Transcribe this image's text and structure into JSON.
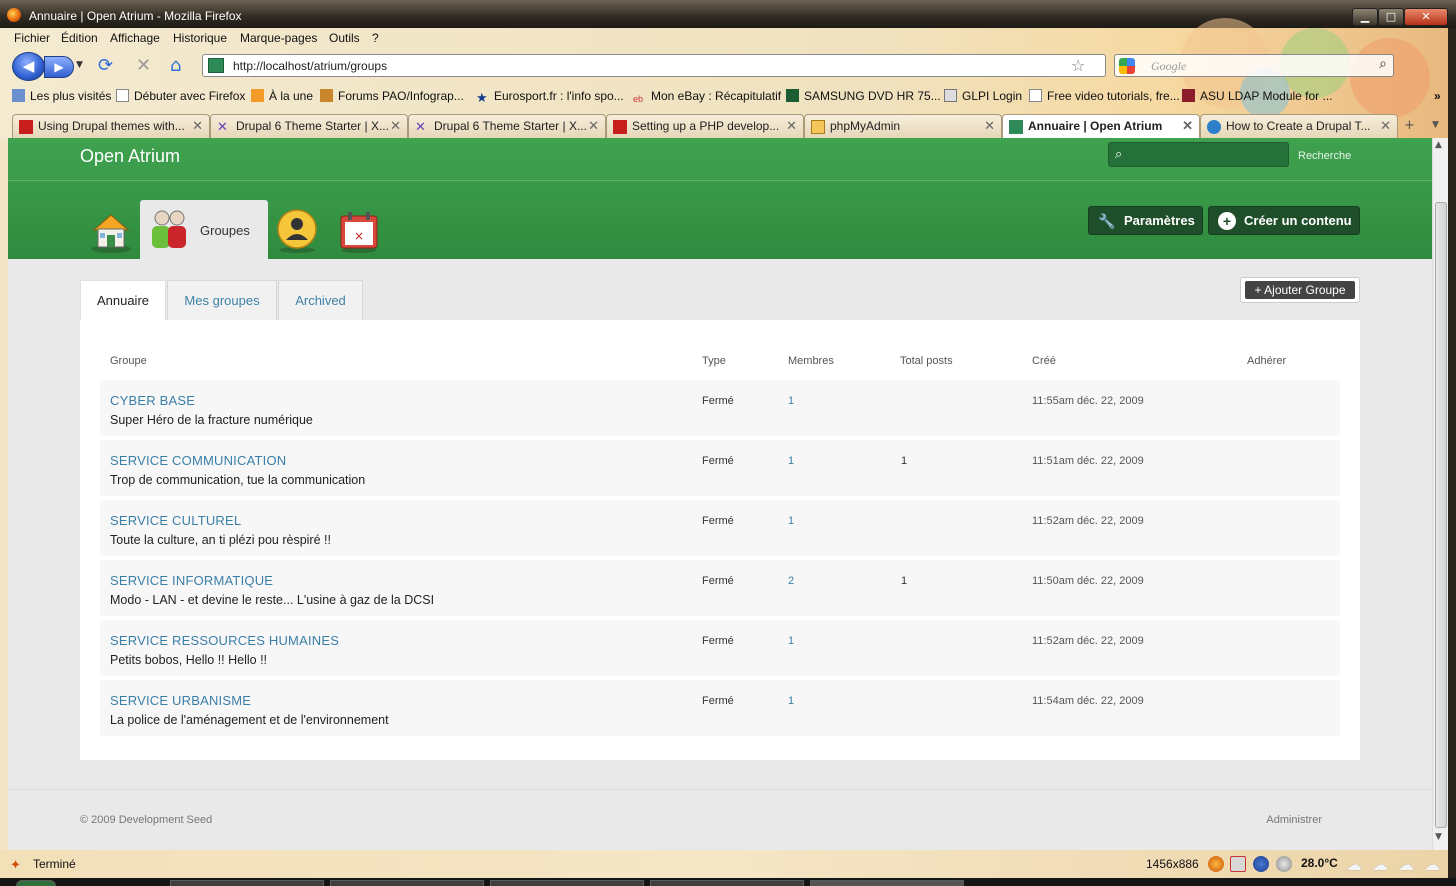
{
  "window": {
    "title": "Annuaire | Open Atrium - Mozilla Firefox",
    "controls": {
      "minimize": "▁",
      "maximize": "□",
      "close": "✕"
    }
  },
  "menubar": [
    "Fichier",
    "Édition",
    "Affichage",
    "Historique",
    "Marque-pages",
    "Outils",
    "?"
  ],
  "navbar": {
    "url": "http://localhost/atrium/groups",
    "search_placeholder": "Google"
  },
  "bookmarks": [
    "Les plus visités",
    "Débuter avec Firefox",
    "À la une",
    "Forums PAO/Infograp...",
    "Eurosport.fr : l'info spo...",
    "Mon eBay : Récapitulatif",
    "SAMSUNG DVD HR 75...",
    "GLPI Login",
    "Free video tutorials, fre...",
    "ASU LDAP Module for ..."
  ],
  "bookmarks_overflow": "»",
  "tabs": [
    "Using Drupal themes with...",
    "Drupal 6 Theme Starter | X...",
    "Drupal 6 Theme Starter | X...",
    "Setting up a PHP develop...",
    "phpMyAdmin",
    "Annuaire | Open Atrium",
    "How to Create a Drupal T..."
  ],
  "tab_close": "✕",
  "site": {
    "name": "Open Atrium",
    "search_label": "Recherche",
    "spaces": {
      "groups_label": "Groupes"
    },
    "buttons": {
      "settings": "Paramètres",
      "create": "Créer un contenu"
    },
    "subtabs": [
      "Annuaire",
      "Mes groupes",
      "Archived"
    ],
    "add_group": "+ Ajouter Groupe",
    "table": {
      "headers": [
        "Groupe",
        "Type",
        "Membres",
        "Total posts",
        "Créé",
        "Adhérer"
      ],
      "rows": [
        {
          "name": "CYBER BASE",
          "desc": "Super Héro de la fracture numérique",
          "type": "Fermé",
          "members": "1",
          "posts": "",
          "created": "11:55am déc. 22, 2009"
        },
        {
          "name": "SERVICE COMMUNICATION",
          "desc": "Trop de communication, tue la communication",
          "type": "Fermé",
          "members": "1",
          "posts": "1",
          "created": "11:51am déc. 22, 2009"
        },
        {
          "name": "SERVICE CULTUREL",
          "desc": "Toute la culture, an ti plézi pou rèspiré !!",
          "type": "Fermé",
          "members": "1",
          "posts": "",
          "created": "11:52am déc. 22, 2009"
        },
        {
          "name": "SERVICE INFORMATIQUE",
          "desc": "Modo - LAN - et devine le reste... L'usine à gaz de la DCSI",
          "type": "Fermé",
          "members": "2",
          "posts": "1",
          "created": "11:50am déc. 22, 2009"
        },
        {
          "name": "SERVICE RESSOURCES HUMAINES",
          "desc": "Petits bobos, Hello !! Hello !!",
          "type": "Fermé",
          "members": "1",
          "posts": "",
          "created": "11:52am déc. 22, 2009"
        },
        {
          "name": "SERVICE URBANISME",
          "desc": "La police de l'aménagement et de l'environnement",
          "type": "Fermé",
          "members": "1",
          "posts": "",
          "created": "11:54am déc. 22, 2009"
        }
      ]
    },
    "footer": {
      "copyright": "© 2009 Development Seed",
      "admin": "Administrer"
    }
  },
  "statusbar": {
    "text": "Terminé",
    "dimensions": "1456x886",
    "temperature": "28.0°C"
  },
  "colors": {
    "header_green": "#3a9a49",
    "header_button": "#1f4f2a",
    "link_blue": "#3b7fa8"
  },
  "icons": [
    "firefox-icon",
    "back-arrow-icon",
    "forward-arrow-icon",
    "reload-icon",
    "stop-icon",
    "home-icon",
    "bookmark-star-icon",
    "search-icon",
    "dashboard-house-icon",
    "groups-people-icon",
    "profile-user-icon",
    "calendar-icon",
    "wrench-icon",
    "plus-circle-icon",
    "weather-cloud-icon"
  ]
}
